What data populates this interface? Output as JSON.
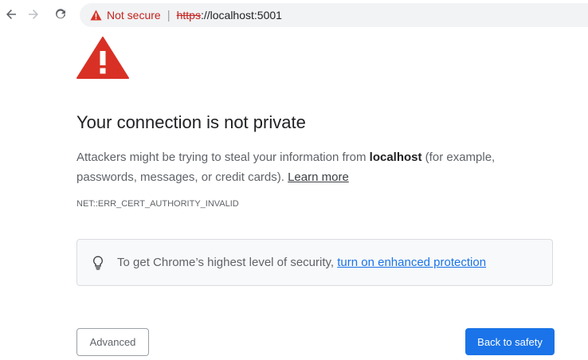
{
  "browser": {
    "security_chip": {
      "label": "Not secure",
      "separator": "|"
    },
    "url": {
      "scheme": "https",
      "rest": "://localhost:5001"
    },
    "icons": {
      "back": "back-arrow-icon",
      "forward": "forward-arrow-icon",
      "reload": "reload-icon",
      "chip_warning": "warning-triangle-icon"
    }
  },
  "interstitial": {
    "warning_icon": "warning-triangle-icon",
    "headline": "Your connection is not private",
    "body": {
      "prefix": "Attackers might be trying to steal your information from ",
      "host": "localhost",
      "suffix": " (for example, passwords, messages, or credit cards). ",
      "learn_more": "Learn more"
    },
    "error_code": "NET::ERR_CERT_AUTHORITY_INVALID",
    "enhanced_protection": {
      "icon": "lightbulb-icon",
      "text": "To get Chrome’s highest level of security, ",
      "link": "turn on enhanced protection"
    },
    "buttons": {
      "advanced": "Advanced",
      "back_to_safety": "Back to safety"
    }
  },
  "colors": {
    "warning_red": "#d93025",
    "not_secure_text": "#c5221f",
    "link_blue": "#1a73e8",
    "primary_button": "#1a73e8",
    "headline": "#202124",
    "body_text": "#5f6368"
  }
}
